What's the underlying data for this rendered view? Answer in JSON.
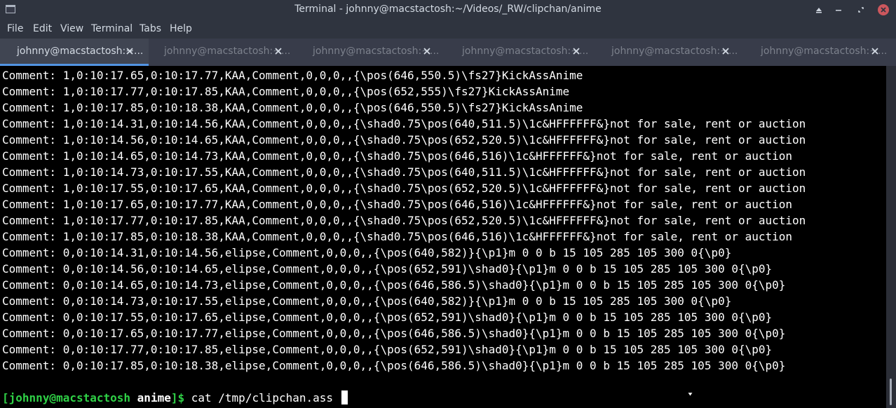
{
  "window": {
    "title": "Terminal - johnny@macstactosh:~/Videos/_RW/clipchan/anime",
    "controls": [
      "maximize-up-icon",
      "minimize-icon",
      "restore-icon",
      "close-icon"
    ]
  },
  "menu": {
    "items": [
      "File",
      "Edit",
      "View",
      "Terminal",
      "Tabs",
      "Help"
    ]
  },
  "tabs": [
    {
      "label": "johnny@macstactosh:~...",
      "active": true
    },
    {
      "label": "johnny@macstactosh:~...",
      "active": false
    },
    {
      "label": "johnny@macstactosh:~...",
      "active": false
    },
    {
      "label": "johnny@macstactosh:~...",
      "active": false
    },
    {
      "label": "johnny@macstactosh:~...",
      "active": false
    },
    {
      "label": "johnny@macstactosh:~...",
      "active": false
    }
  ],
  "terminal": {
    "lines": [
      "Comment: 1,0:10:17.65,0:10:17.77,KAA,Comment,0,0,0,,{\\pos(646,550.5)\\fs27}KickAssAnime",
      "Comment: 1,0:10:17.77,0:10:17.85,KAA,Comment,0,0,0,,{\\pos(652,555)\\fs27}KickAssAnime",
      "Comment: 1,0:10:17.85,0:10:18.38,KAA,Comment,0,0,0,,{\\pos(646,550.5)\\fs27}KickAssAnime",
      "Comment: 1,0:10:14.31,0:10:14.56,KAA,Comment,0,0,0,,{\\shad0.75\\pos(640,511.5)\\1c&HFFFFFF&}not for sale, rent or auction",
      "Comment: 1,0:10:14.56,0:10:14.65,KAA,Comment,0,0,0,,{\\shad0.75\\pos(652,520.5)\\1c&HFFFFFF&}not for sale, rent or auction",
      "Comment: 1,0:10:14.65,0:10:14.73,KAA,Comment,0,0,0,,{\\shad0.75\\pos(646,516)\\1c&HFFFFFF&}not for sale, rent or auction",
      "Comment: 1,0:10:14.73,0:10:17.55,KAA,Comment,0,0,0,,{\\shad0.75\\pos(640,511.5)\\1c&HFFFFFF&}not for sale, rent or auction",
      "Comment: 1,0:10:17.55,0:10:17.65,KAA,Comment,0,0,0,,{\\shad0.75\\pos(652,520.5)\\1c&HFFFFFF&}not for sale, rent or auction",
      "Comment: 1,0:10:17.65,0:10:17.77,KAA,Comment,0,0,0,,{\\shad0.75\\pos(646,516)\\1c&HFFFFFF&}not for sale, rent or auction",
      "Comment: 1,0:10:17.77,0:10:17.85,KAA,Comment,0,0,0,,{\\shad0.75\\pos(652,520.5)\\1c&HFFFFFF&}not for sale, rent or auction",
      "Comment: 1,0:10:17.85,0:10:18.38,KAA,Comment,0,0,0,,{\\shad0.75\\pos(646,516)\\1c&HFFFFFF&}not for sale, rent or auction",
      "Comment: 0,0:10:14.31,0:10:14.56,elipse,Comment,0,0,0,,{\\pos(640,582)}{\\p1}m 0 0 b 15 105 285 105 300 0{\\p0}",
      "Comment: 0,0:10:14.56,0:10:14.65,elipse,Comment,0,0,0,,{\\pos(652,591)\\shad0}{\\p1}m 0 0 b 15 105 285 105 300 0{\\p0}",
      "Comment: 0,0:10:14.65,0:10:14.73,elipse,Comment,0,0,0,,{\\pos(646,586.5)\\shad0}{\\p1}m 0 0 b 15 105 285 105 300 0{\\p0}",
      "Comment: 0,0:10:14.73,0:10:17.55,elipse,Comment,0,0,0,,{\\pos(640,582)}{\\p1}m 0 0 b 15 105 285 105 300 0{\\p0}",
      "Comment: 0,0:10:17.55,0:10:17.65,elipse,Comment,0,0,0,,{\\pos(652,591)\\shad0}{\\p1}m 0 0 b 15 105 285 105 300 0{\\p0}",
      "Comment: 0,0:10:17.65,0:10:17.77,elipse,Comment,0,0,0,,{\\pos(646,586.5)\\shad0}{\\p1}m 0 0 b 15 105 285 105 300 0{\\p0}",
      "Comment: 0,0:10:17.77,0:10:17.85,elipse,Comment,0,0,0,,{\\pos(652,591)\\shad0}{\\p1}m 0 0 b 15 105 285 105 300 0{\\p0}",
      "Comment: 0,0:10:17.85,0:10:18.38,elipse,Comment,0,0,0,,{\\pos(646,586.5)\\shad0}{\\p1}m 0 0 b 15 105 285 105 300 0{\\p0}"
    ],
    "prompt": {
      "user_host": "[johnny@macstactosh",
      "dir": "anime",
      "suffix": "]$",
      "command": "cat /tmp/clipchan.ass"
    }
  },
  "colors": {
    "prompt_green": "#2fd046",
    "accent": "#5294e2",
    "close_red": "#cc575d",
    "terminal_bg": "#000000"
  }
}
